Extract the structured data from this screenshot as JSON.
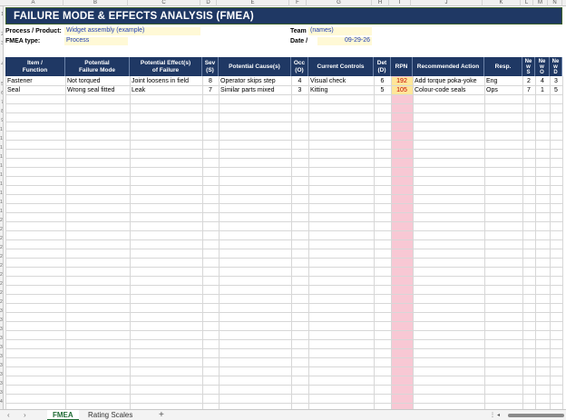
{
  "columns": [
    "A",
    "B",
    "C",
    "D",
    "E",
    "F",
    "G",
    "H",
    "I",
    "J",
    "K",
    "L",
    "M",
    "N"
  ],
  "rows": [
    "1",
    "2",
    "3",
    "4",
    "5",
    "6",
    "7",
    "8",
    "9",
    "10",
    "11",
    "12",
    "13",
    "14",
    "15",
    "16",
    "17",
    "18",
    "19",
    "20",
    "21",
    "22",
    "23",
    "24",
    "25",
    "26",
    "27",
    "28",
    "29",
    "30",
    "31",
    "32",
    "33",
    "34",
    "35",
    "36",
    "37",
    "38",
    "39",
    "40",
    "41",
    "42",
    "43",
    "44",
    "45"
  ],
  "title": "FAILURE MODE & EFFECTS ANALYSIS (FMEA)",
  "meta": {
    "process_label": "Process / Product:",
    "process_value": "Widget assembly (example)",
    "fmea_type_label": "FMEA type:",
    "fmea_type_value": "Process",
    "team_label": "Team",
    "team_value": "(names)",
    "date_label": "Date /",
    "date_value": "09-29-26"
  },
  "headers": [
    "Item /\nFunction",
    "Potential\nFailure Mode",
    "Potential Effect(s)\nof Failure",
    "Sev\n(S)",
    "Potential Cause(s)",
    "Occ\n(O)",
    "Current Controls",
    "Det\n(D)",
    "RPN",
    "Recommended Action",
    "Resp.",
    "Ne\nw\nS",
    "Ne\nw\nO",
    "Ne\nw\nD"
  ],
  "table_rows": [
    {
      "item": "Fastener",
      "mode": "Not torqued",
      "effect": "Joint loosens in field",
      "sev": "8",
      "cause": "Operator skips step",
      "occ": "4",
      "controls": "Visual check",
      "det": "6",
      "rpn": "192",
      "action": "Add torque poka-yoke",
      "resp": "Eng",
      "new_s": "2",
      "new_o": "4",
      "new_d": "3"
    },
    {
      "item": "Seal",
      "mode": "Wrong seal fitted",
      "effect": "Leak",
      "sev": "7",
      "cause": "Similar parts mixed",
      "occ": "3",
      "controls": "Kitting",
      "det": "5",
      "rpn": "105",
      "action": "Colour-code seals",
      "resp": "Ops",
      "new_s": "7",
      "new_o": "1",
      "new_d": "5"
    }
  ],
  "tabs": [
    "FMEA",
    "Rating Scales"
  ],
  "add_sheet": "+",
  "colors": {
    "header_navy": "#1f3864",
    "rpn_pink": "#f8c8d4",
    "rpn_highlight": "#ffe699",
    "active_tab": "#1f6b34",
    "link_blue": "#1f3fb5"
  }
}
